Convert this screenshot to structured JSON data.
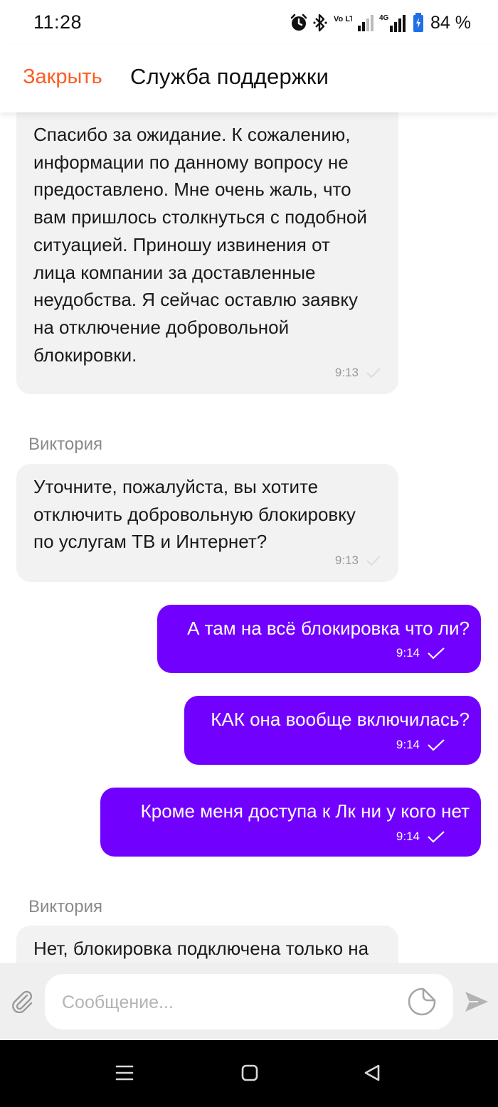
{
  "status_bar": {
    "time": "11:28",
    "battery": "84 %",
    "volte_label": "Vo LTE2",
    "network_label": "4G"
  },
  "header": {
    "close_label": "Закрыть",
    "title": "Служба поддержки"
  },
  "messages": [
    {
      "direction": "in",
      "text": "Спасибо за ожидание. К сожалению,\nинформации по данному вопросу не\nпредоставлено. Мне очень жаль, что\nвам пришлось столкнуться с подобной\nситуацией. Приношу извинения от\nлица компании за доставленные\nнеудобства. Я сейчас оставлю заявку\nна отключение добровольной\nблокировки.",
      "time": "9:13"
    },
    {
      "direction": "in",
      "sender": "Виктория",
      "text": "Уточните, пожалуйста, вы хотите\nотключить добровольную блокировку\nпо услугам ТВ и Интернет?",
      "time": "9:13"
    },
    {
      "direction": "out",
      "text": "А там на всё блокировка что ли?",
      "time": "9:14"
    },
    {
      "direction": "out",
      "text": "КАК она вообще включилась?",
      "time": "9:14"
    },
    {
      "direction": "out",
      "text": "Кроме меня доступа к Лк ни у кого нет",
      "time": "9:14"
    },
    {
      "direction": "in",
      "sender": "Виктория",
      "text": "Нет, блокировка подключена только на",
      "time": ""
    }
  ],
  "composer": {
    "placeholder": "Сообщение..."
  },
  "colors": {
    "accent_orange": "#ff5c1f",
    "outgoing_bubble": "#7100ff",
    "incoming_bubble": "#f2f2f2"
  }
}
